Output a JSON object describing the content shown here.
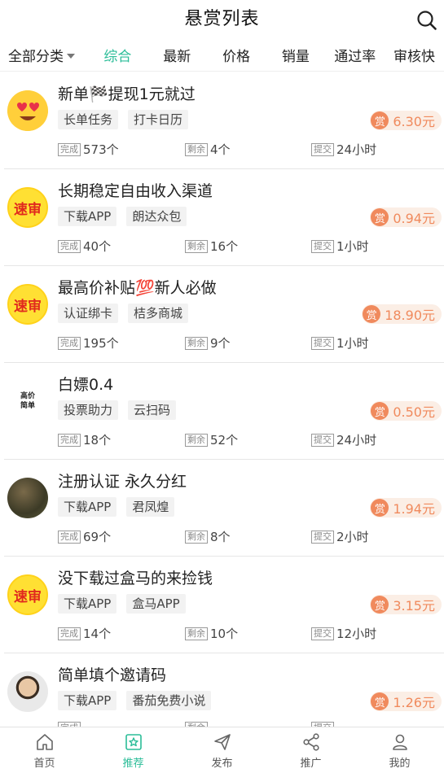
{
  "header": {
    "title": "悬赏列表"
  },
  "filters": {
    "category": "全部分类",
    "tabs": [
      "综合",
      "最新",
      "价格",
      "销量",
      "通过率",
      "审核快"
    ]
  },
  "stat_labels": {
    "done": "完成",
    "left": "剩余",
    "submit": "提交"
  },
  "reward_badge": "赏",
  "tasks": [
    {
      "avatar": "heart-eyes-emoji",
      "title": "新单🏁提现1元就过",
      "tags": [
        "长单任务",
        "打卡日历"
      ],
      "reward": "6.30元",
      "done": "573个",
      "left": "4个",
      "submit": "24小时"
    },
    {
      "avatar": "速审",
      "title": "长期稳定自由收入渠道",
      "tags": [
        "下载APP",
        "朗达众包"
      ],
      "reward": "0.94元",
      "done": "40个",
      "left": "16个",
      "submit": "1小时"
    },
    {
      "avatar": "速审",
      "title": "最高价补贴💯新人必做",
      "tags": [
        "认证绑卡",
        "桔多商城"
      ],
      "reward": "18.90元",
      "done": "195个",
      "left": "9个",
      "submit": "1小时"
    },
    {
      "avatar": "高价 简单",
      "title": "白嫖0.4",
      "tags": [
        "投票助力",
        "云扫码"
      ],
      "reward": "0.50元",
      "done": "18个",
      "left": "52个",
      "submit": "24小时"
    },
    {
      "avatar": "photo-garden",
      "title": "注册认证 永久分红",
      "tags": [
        "下载APP",
        "君凤煌"
      ],
      "reward": "1.94元",
      "done": "69个",
      "left": "8个",
      "submit": "2小时"
    },
    {
      "avatar": "速审",
      "title": "没下载过盒马的来捡钱",
      "tags": [
        "下载APP",
        "盒马APP"
      ],
      "reward": "3.15元",
      "done": "14个",
      "left": "10个",
      "submit": "12小时"
    },
    {
      "avatar": "photo-person",
      "title": "简单填个邀请码",
      "tags": [
        "下载APP",
        "番茄免费小说"
      ],
      "reward": "1.26元",
      "done": "",
      "left": "",
      "submit": ""
    }
  ],
  "tabbar": [
    {
      "label": "首页",
      "icon": "home-icon",
      "active": false
    },
    {
      "label": "推荐",
      "icon": "recommend-icon",
      "active": true
    },
    {
      "label": "发布",
      "icon": "send-icon",
      "active": false
    },
    {
      "label": "推广",
      "icon": "share-icon",
      "active": false
    },
    {
      "label": "我的",
      "icon": "user-icon",
      "active": false
    }
  ],
  "colors": {
    "accent": "#2bbd98",
    "reward": "#f08a5d",
    "reward_bg": "#fbeee5",
    "speed_badge": "#ffe033"
  }
}
